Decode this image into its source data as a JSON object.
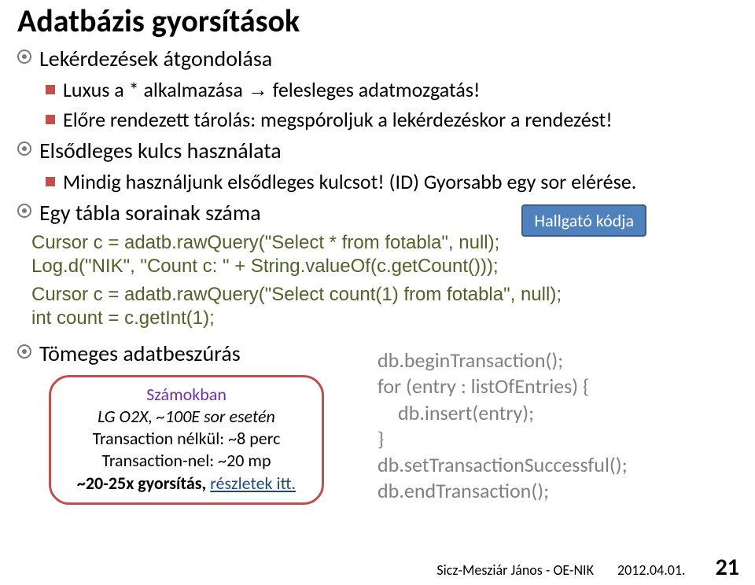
{
  "title": "Adatbázis gyorsítások",
  "bullets": {
    "b1": "Lekérdezések átgondolása",
    "b1a_pre": "Luxus a * alkalmazása ",
    "b1a_arrow": "→",
    "b1a_post": " felesleges adatmozgatás!",
    "b1b": "Előre rendezett tárolás: megspóroljuk a lekérdezéskor a rendezést!",
    "b2": "Elsődleges kulcs használata",
    "b2a": "Mindig használjunk elsődleges kulcsot! (ID) Gyorsabb egy sor elérése.",
    "b3": "Egy tábla sorainak száma",
    "b4": "Tömeges adatbeszúrás"
  },
  "badge": "Hallgató kódja",
  "code1": "Cursor c = adatb.rawQuery(\"Select * from fotabla\", null);\nLog.d(\"NIK\", \"Count c: \" + String.valueOf(c.getCount()));",
  "code2": "Cursor c = adatb.rawQuery(\"Select count(1) from fotabla\", null);\nint count = c.getInt(1);",
  "tx": {
    "l1": "db.beginTransaction();",
    "l2": "for (entry : listOfEntries) {",
    "l3": "db.insert(entry);",
    "l4": "}",
    "l5": "db.setTransactionSuccessful();",
    "l6": "db.endTransaction();"
  },
  "callout": {
    "hdr": "Számokban",
    "l1": "LG O2X, ~100E sor esetén",
    "l2": "Transaction nélkül: ~8 perc",
    "l3": "Transaction-nel: ~20 mp",
    "l4a": "~20-25x gyorsítás, ",
    "l4b": "részletek itt."
  },
  "footer": {
    "author": "Sicz-Mesziár János - OE-NIK",
    "date": "2012.04.01.",
    "page": "21"
  }
}
